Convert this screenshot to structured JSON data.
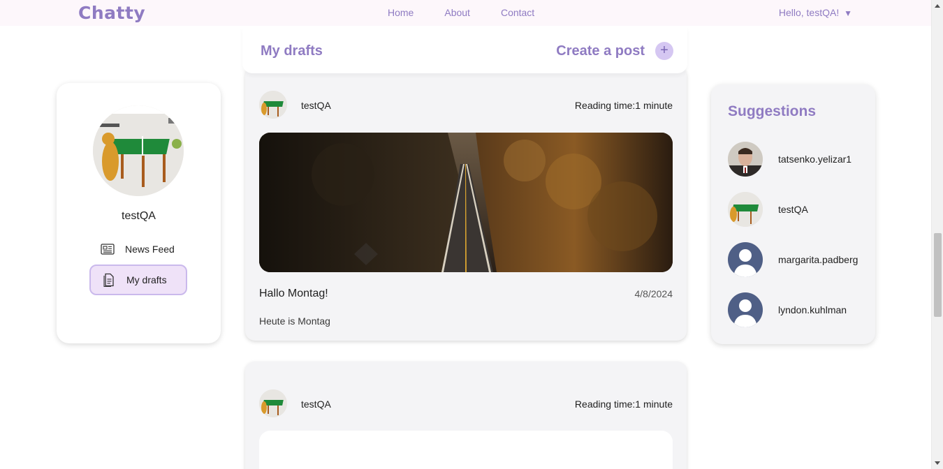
{
  "header": {
    "logo": "Chatty",
    "nav": [
      {
        "label": "Home"
      },
      {
        "label": "About"
      },
      {
        "label": "Contact"
      }
    ],
    "greeting": "Hello, testQA!",
    "greeting_arrow": "▼"
  },
  "sidebar": {
    "username": "testQA",
    "items": [
      {
        "label": "News Feed",
        "icon": "newspaper-icon",
        "active": false
      },
      {
        "label": "My drafts",
        "icon": "document-icon",
        "active": true
      }
    ]
  },
  "drafts_bar": {
    "title": "My drafts",
    "create_label": "Create a post",
    "plus_symbol": "+"
  },
  "posts": [
    {
      "author": "testQA",
      "reading_time": "Reading time:1 minute",
      "title": "Hallo Montag!",
      "date": "4/8/2024",
      "body": "Heute is Montag"
    },
    {
      "author": "testQA",
      "reading_time": "Reading time:1 minute"
    }
  ],
  "suggestions": {
    "title": "Suggestions",
    "users": [
      {
        "name": "tatsenko.yelizar1"
      },
      {
        "name": "testQA"
      },
      {
        "name": "margarita.padberg"
      },
      {
        "name": "lyndon.kuhlman"
      }
    ]
  },
  "colors": {
    "accent": "#8f7bc2",
    "header_bg": "#fdf7fb",
    "active_item_bg": "#efe2f8",
    "card_bg": "#f4f4f6"
  }
}
